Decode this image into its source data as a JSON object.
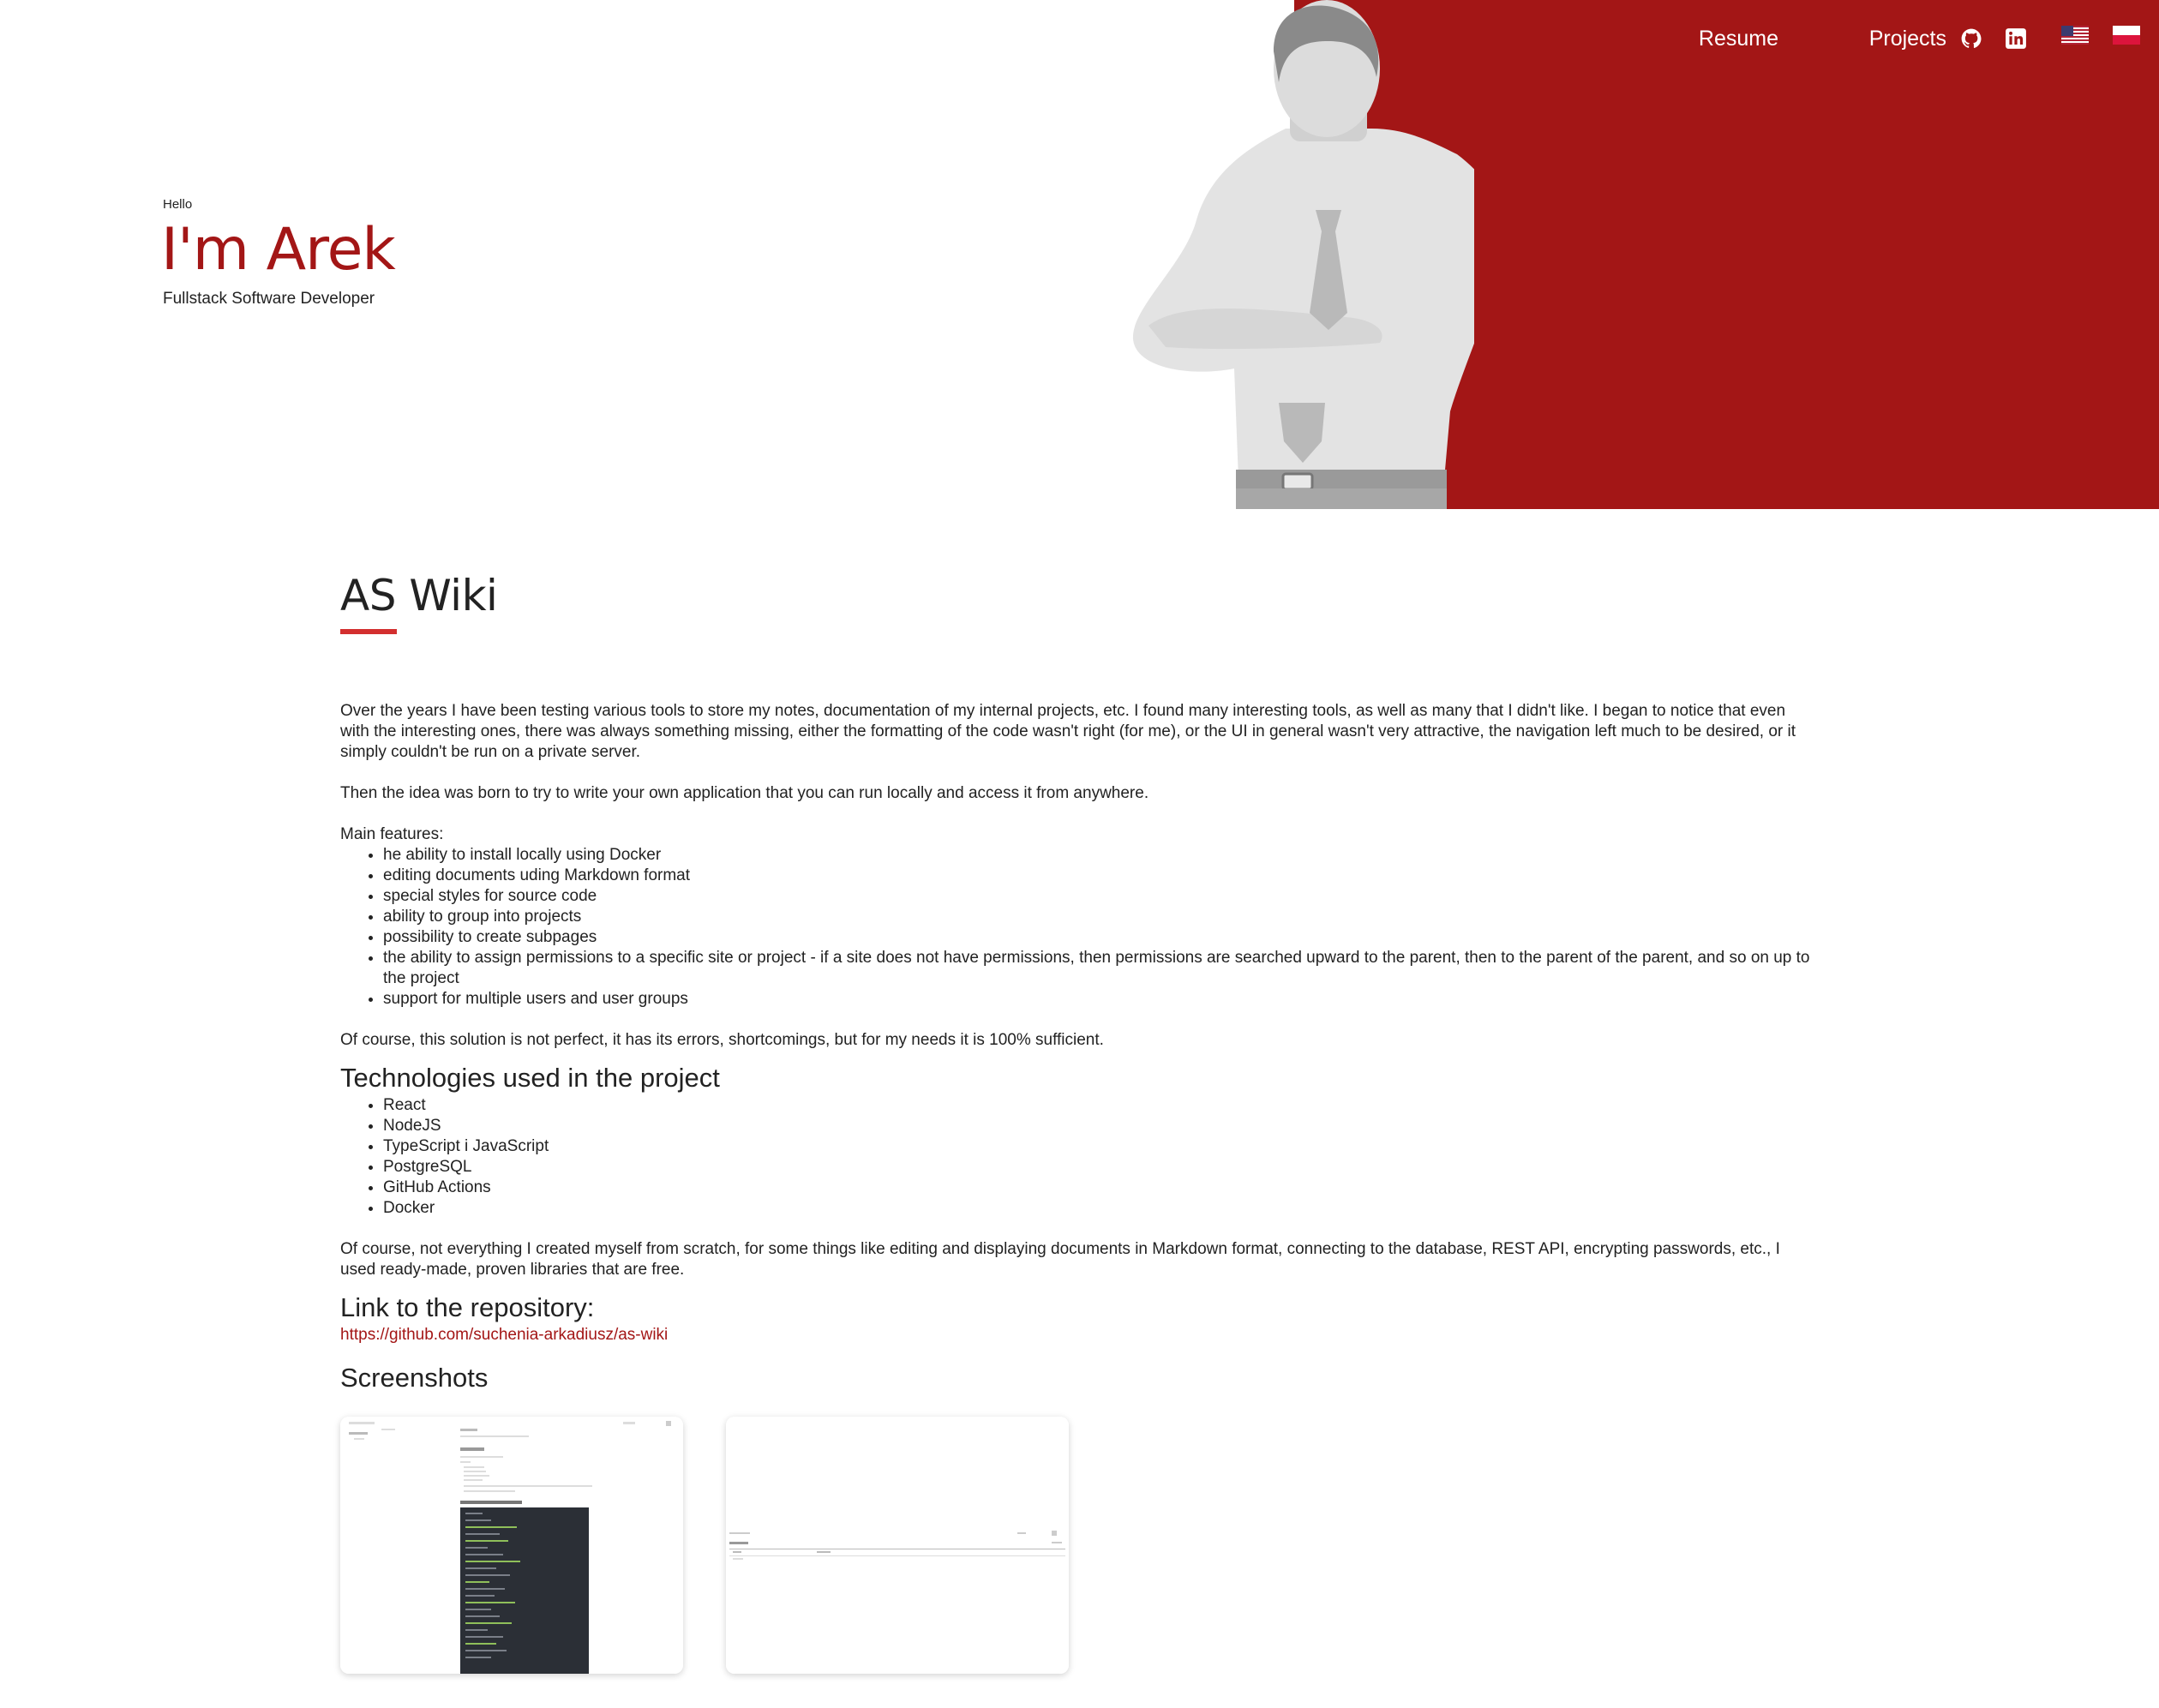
{
  "nav": {
    "resume": "Resume",
    "projects": "Projects",
    "github_icon": "github-icon",
    "linkedin_icon": "linkedin-icon",
    "lang_en_icon": "us-flag-icon",
    "lang_pl_icon": "pl-flag-icon"
  },
  "hero": {
    "greeting": "Hello",
    "name": "I'm Arek",
    "role": "Fullstack Software Developer",
    "accent_color": "#a31616"
  },
  "project": {
    "title": "AS Wiki",
    "intro_1": "Over the years I have been testing various tools to store my notes, documentation of my internal projects, etc. I found many interesting tools, as well as many that I didn't like. I began to notice that even with the interesting ones, there was always something missing, either the formatting of the code wasn't right (for me), or the UI in general wasn't very attractive, the navigation left much to be desired, or it simply couldn't be run on a private server.",
    "intro_2": "Then the idea was born to try to write your own application that you can run locally and access it from anywhere.",
    "features_label": "Main features:",
    "features": [
      "he ability to install locally using Docker",
      "editing documents uding Markdown format",
      "special styles for source code",
      "ability to group into projects",
      "possibility to create subpages",
      "the ability to assign permissions to a specific site or project - if a site does not have permissions, then permissions are searched upward to the parent, then to the parent of the parent, and so on up to the project",
      "support for multiple users and user groups"
    ],
    "conclusion": "Of course, this solution is not perfect, it has its errors, shortcomings, but for my needs it is 100% sufficient.",
    "tech_heading": "Technologies used in the project",
    "technologies": [
      "React",
      "NodeJS",
      "TypeScript i JavaScript",
      "PostgreSQL",
      "GitHub Actions",
      "Docker"
    ],
    "libraries_note": "Of course, not everything I created myself from scratch, for some things like editing and displaying documents in Markdown format, connecting to the database, REST API, encrypting passwords, etc., I used ready-made, proven libraries that are free.",
    "repo_heading": "Link to the repository:",
    "repo_url": "https://github.com/suchenia-arkadiusz/as-wiki",
    "screenshots_heading": "Screenshots"
  },
  "screenshots": [
    {
      "name": "screenshot-document-view"
    },
    {
      "name": "screenshot-projects-list"
    }
  ]
}
